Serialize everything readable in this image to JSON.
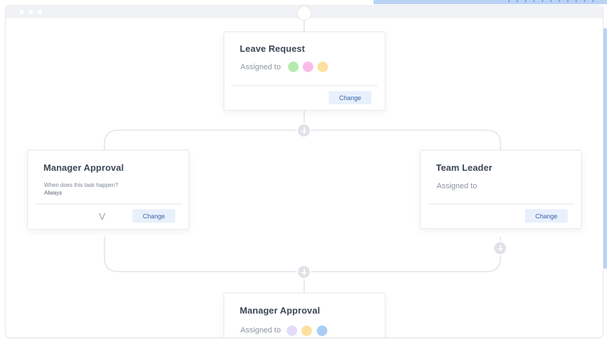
{
  "colors": {
    "accent_strip": "#b9d3f5",
    "card_title": "#3e4757",
    "button_bg": "#e8f0fb",
    "button_text": "#3b64a8",
    "connector": "#dcdfe4"
  },
  "cards": {
    "leave_request": {
      "title": "Leave Request",
      "assigned_label": "Assigned to",
      "avatars": [
        "#b6eab0",
        "#fbbbe9",
        "#fde0a0"
      ],
      "change_label": "Change"
    },
    "manager_approval_top": {
      "title": "Manager Approval",
      "question": "When does this task happen?",
      "answer": "Always",
      "chevron": "V",
      "change_label": "Change"
    },
    "team_leader": {
      "title": "Team Leader",
      "assigned_label": "Assigned to",
      "change_label": "Change"
    },
    "manager_approval_bottom": {
      "title": "Manager Approval",
      "assigned_label": "Assigned to",
      "avatars": [
        "#e3dbf9",
        "#fde0a0",
        "#a9cdf5"
      ]
    }
  },
  "icons": {
    "add": "plus-circle-icon",
    "expand": "chevron-down-icon"
  }
}
